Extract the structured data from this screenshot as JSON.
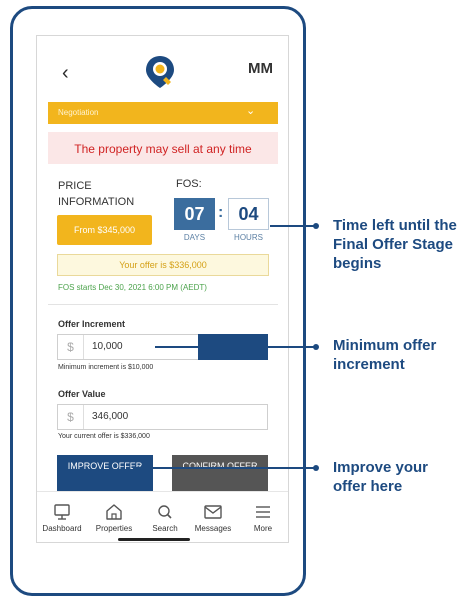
{
  "header": {
    "back_icon": "chevron-left-icon",
    "logo_icon": "location-pin-logo-icon",
    "avatar_initials": "MM"
  },
  "negotiation": {
    "label": "Negotiation",
    "chevron_icon": "chevron-down-icon"
  },
  "warning": "The property may sell at any time",
  "price_info": {
    "label": "PRICE INFORMATION",
    "from_button": "From $345,000"
  },
  "fos": {
    "label": "FOS:",
    "days": "07",
    "hours": "04",
    "days_label": "DAYS",
    "hours_label": "HOURS",
    "separator": ":"
  },
  "offer_banner": "Your offer is $336,000",
  "fos_start": "FOS starts Dec 30, 2021 6:00 PM (AEDT)",
  "increment": {
    "label": "Offer Increment",
    "currency": "$",
    "value": "10,000",
    "note": "Minimum increment is $10,000"
  },
  "offer_value": {
    "label": "Offer Value",
    "currency": "$",
    "value": "346,000",
    "note": "Your current offer is $336,000"
  },
  "buttons": {
    "improve": "IMPROVE OFFER",
    "confirm": "CONFIRM OFFER"
  },
  "nav": [
    {
      "label": "Dashboard",
      "icon": "monitor-icon"
    },
    {
      "label": "Properties",
      "icon": "home-icon"
    },
    {
      "label": "Search",
      "icon": "search-icon"
    },
    {
      "label": "Messages",
      "icon": "mail-icon"
    },
    {
      "label": "More",
      "icon": "menu-icon"
    }
  ],
  "annotations": {
    "time_left": "Time left until the Final Offer Stage begins",
    "min_increment": "Minimum offer increment",
    "improve": "Improve your offer here"
  },
  "colors": {
    "brand_blue": "#1d4a80",
    "accent_yellow": "#f2b51d",
    "warning_red": "#d02323",
    "success_green": "#4ca34c"
  }
}
